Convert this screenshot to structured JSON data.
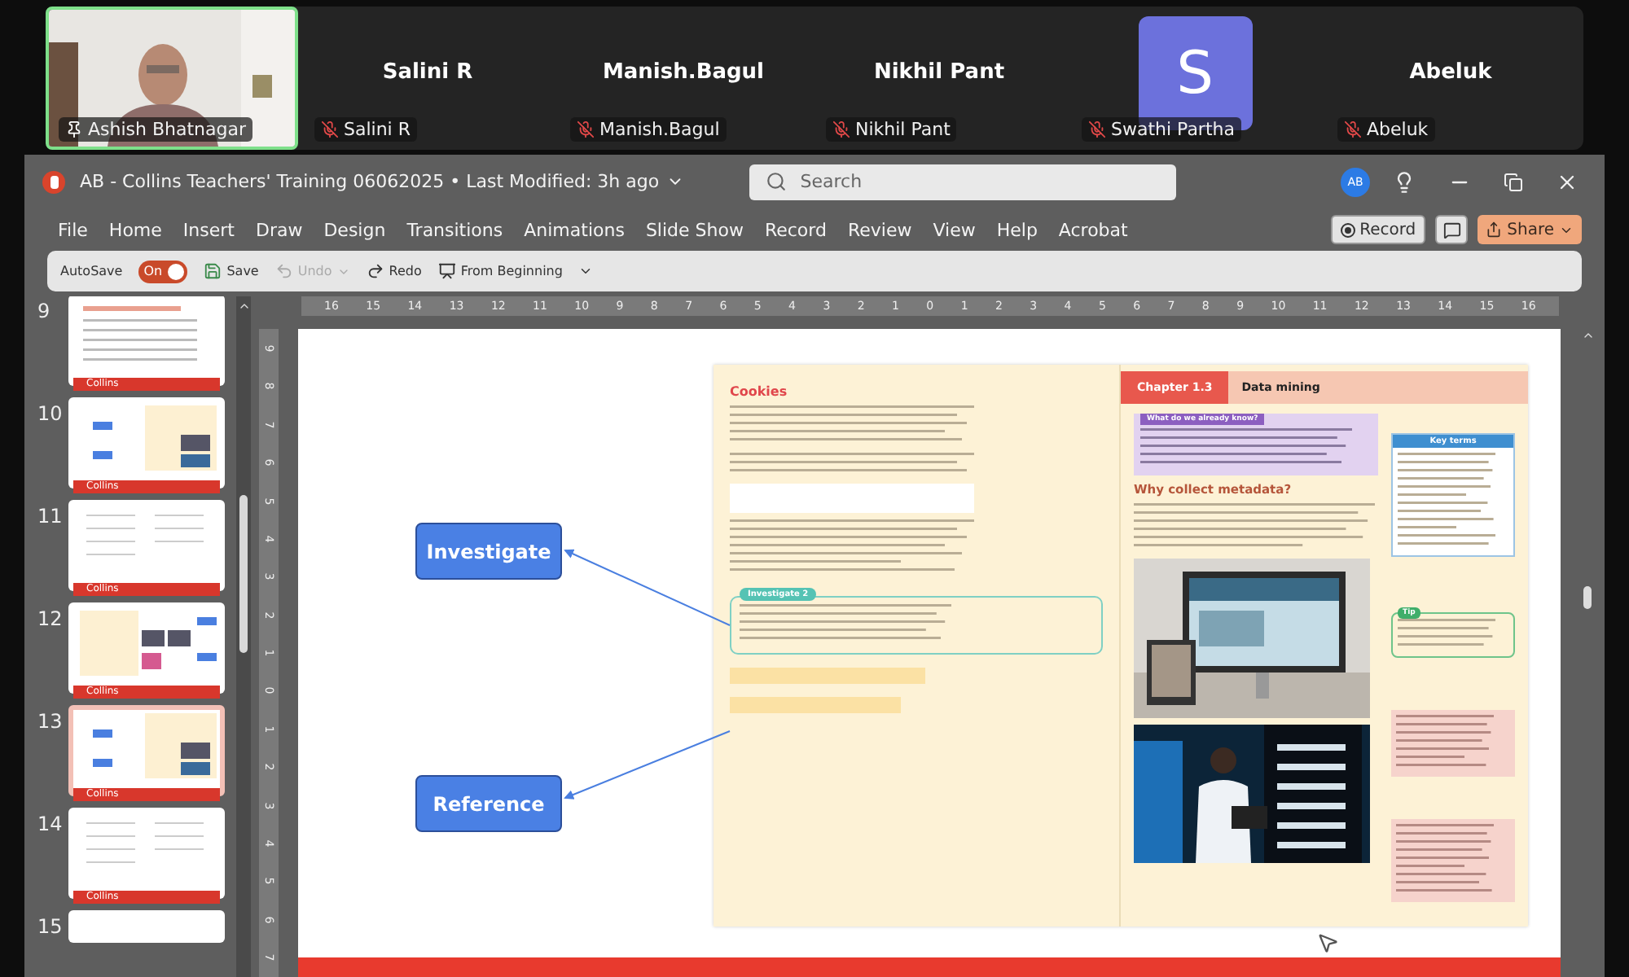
{
  "call": {
    "participants": [
      {
        "kind": "video",
        "label": "Ashish Bhatnagar",
        "muted": false,
        "pinned": true,
        "speaking": true
      },
      {
        "kind": "name",
        "title": "Salini R",
        "label": "Salini R",
        "muted": true,
        "pinned": false,
        "speaking": false
      },
      {
        "kind": "name",
        "title": "Manish.Bagul",
        "label": "Manish.Bagul",
        "muted": true,
        "pinned": false,
        "speaking": false
      },
      {
        "kind": "name",
        "title": "Nikhil Pant",
        "label": "Nikhil Pant",
        "muted": true,
        "pinned": false,
        "speaking": false
      },
      {
        "kind": "avatar",
        "avatar": "S",
        "label": "Swathi Partha",
        "muted": true,
        "pinned": false,
        "speaking": false
      },
      {
        "kind": "name",
        "title": "Abeluk",
        "label": "Abeluk",
        "muted": true,
        "pinned": false,
        "speaking": false
      }
    ]
  },
  "app": {
    "title": "AB - Collins Teachers' Training 06062025 • Last Modified: 3h ago",
    "search": {
      "placeholder": "Search"
    },
    "account": "AB",
    "menu": [
      "File",
      "Home",
      "Insert",
      "Draw",
      "Design",
      "Transitions",
      "Animations",
      "Slide Show",
      "Record",
      "Review",
      "View",
      "Help",
      "Acrobat"
    ],
    "record_button": "Record",
    "share_button": "Share",
    "quick_toolbar": {
      "autosave": "AutoSave",
      "toggle": {
        "label": "On",
        "on": true
      },
      "items": [
        {
          "kind": "save",
          "label": "Save",
          "disabled": false
        },
        {
          "kind": "undo",
          "label": "Undo",
          "disabled": true
        },
        {
          "kind": "redo",
          "label": "Redo",
          "disabled": false
        },
        {
          "kind": "present",
          "label": "From Beginning",
          "disabled": false
        }
      ]
    }
  },
  "slides": [
    {
      "number": "9",
      "kind": "text",
      "footer": "Collins",
      "selected": false
    },
    {
      "number": "10",
      "kind": "mindmap",
      "footer": "Collins",
      "selected": false
    },
    {
      "number": "11",
      "kind": "form",
      "footer": "Collins",
      "selected": false
    },
    {
      "number": "12",
      "kind": "gallery",
      "footer": "Collins",
      "selected": false
    },
    {
      "number": "13",
      "kind": "mindmap",
      "footer": "Collins",
      "selected": true
    },
    {
      "number": "14",
      "kind": "form",
      "footer": "Collins",
      "selected": false
    },
    {
      "number": "15",
      "kind": "cut"
    }
  ],
  "ruler": {
    "horizontal": [
      "16",
      "15",
      "14",
      "13",
      "12",
      "11",
      "10",
      "9",
      "8",
      "7",
      "6",
      "5",
      "4",
      "3",
      "2",
      "1",
      "0",
      "1",
      "2",
      "3",
      "4",
      "5",
      "6",
      "7",
      "8",
      "9",
      "10",
      "11",
      "12",
      "13",
      "14",
      "15",
      "16"
    ],
    "vertical": [
      "9",
      "8",
      "7",
      "6",
      "5",
      "4",
      "3",
      "2",
      "1",
      "0",
      "1",
      "2",
      "3",
      "4",
      "5",
      "6",
      "7"
    ]
  },
  "slide": {
    "labels": [
      "Investigate",
      "Reference"
    ],
    "book": {
      "left": {
        "heading": "Cookies",
        "callout": "Investigate 2"
      },
      "right": {
        "chapter": "Chapter 1.3",
        "title": "Data mining",
        "box_title": "What do we already know?",
        "key_terms": "Key terms",
        "heading": "Why collect metadata?",
        "tip": "Tip"
      }
    }
  }
}
